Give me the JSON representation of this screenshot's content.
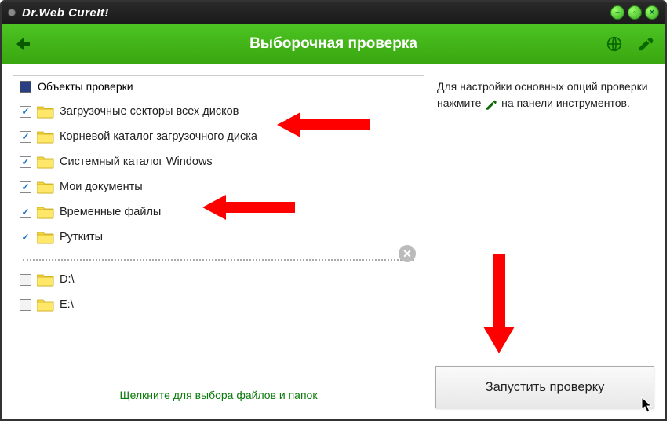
{
  "titlebar": {
    "app_title": "Dr.Web CureIt!"
  },
  "toolbar": {
    "heading": "Выборочная проверка"
  },
  "checklist": {
    "header": "Объекты проверки",
    "items": [
      {
        "label": "Загрузочные секторы всех дисков",
        "checked": true
      },
      {
        "label": "Корневой каталог загрузочного диска",
        "checked": true
      },
      {
        "label": "Системный каталог Windows",
        "checked": true
      },
      {
        "label": "Мои документы",
        "checked": true
      },
      {
        "label": "Временные файлы",
        "checked": true
      },
      {
        "label": "Руткиты",
        "checked": true
      }
    ],
    "drives": [
      {
        "label": "D:\\",
        "checked": false
      },
      {
        "label": "E:\\",
        "checked": false
      }
    ],
    "footer_link": "Щелкните для выбора файлов и папок"
  },
  "sidebar": {
    "help_pre": "Для настройки основных опций проверки нажмите ",
    "help_post": " на панели инструментов."
  },
  "actions": {
    "start_label": "Запустить проверку"
  }
}
